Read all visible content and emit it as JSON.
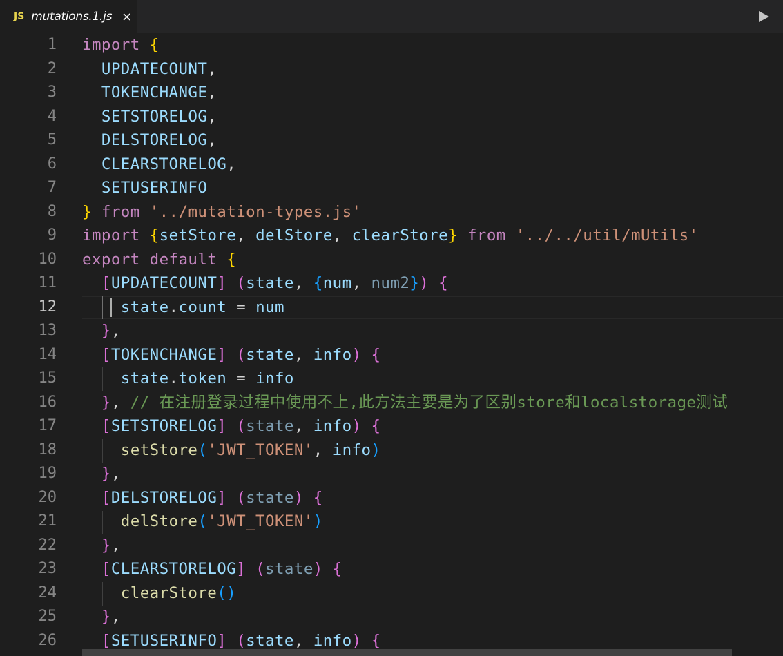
{
  "tab": {
    "icon": "JS",
    "title": "mutations.1.js",
    "close": "×"
  },
  "toolbar": {
    "run_icon": "run-icon"
  },
  "colors": {
    "keyword": "#c586c0",
    "variable": "#9cdcfe",
    "string": "#ce9178",
    "function": "#dcdcaa",
    "comment": "#6a9955"
  },
  "editor": {
    "active_line": 12,
    "lines": [
      {
        "n": "1",
        "tokens": [
          [
            "kw",
            "import"
          ],
          [
            "punc",
            " "
          ],
          [
            "brace1",
            "{"
          ]
        ]
      },
      {
        "n": "2",
        "tokens": [
          [
            "punc",
            "  "
          ],
          [
            "var",
            "UPDATECOUNT"
          ],
          [
            "punc",
            ","
          ]
        ]
      },
      {
        "n": "3",
        "tokens": [
          [
            "punc",
            "  "
          ],
          [
            "var",
            "TOKENCHANGE"
          ],
          [
            "punc",
            ","
          ]
        ]
      },
      {
        "n": "4",
        "tokens": [
          [
            "punc",
            "  "
          ],
          [
            "var",
            "SETSTORELOG"
          ],
          [
            "punc",
            ","
          ]
        ]
      },
      {
        "n": "5",
        "tokens": [
          [
            "punc",
            "  "
          ],
          [
            "var",
            "DELSTORELOG"
          ],
          [
            "punc",
            ","
          ]
        ]
      },
      {
        "n": "6",
        "tokens": [
          [
            "punc",
            "  "
          ],
          [
            "var",
            "CLEARSTORELOG"
          ],
          [
            "punc",
            ","
          ]
        ]
      },
      {
        "n": "7",
        "tokens": [
          [
            "punc",
            "  "
          ],
          [
            "var",
            "SETUSERINFO"
          ]
        ]
      },
      {
        "n": "8",
        "tokens": [
          [
            "brace1",
            "}"
          ],
          [
            "punc",
            " "
          ],
          [
            "kw",
            "from"
          ],
          [
            "punc",
            " "
          ],
          [
            "str",
            "'../mutation-types.js'"
          ]
        ]
      },
      {
        "n": "9",
        "tokens": [
          [
            "kw",
            "import"
          ],
          [
            "punc",
            " "
          ],
          [
            "brace1",
            "{"
          ],
          [
            "var",
            "setStore"
          ],
          [
            "punc",
            ", "
          ],
          [
            "var",
            "delStore"
          ],
          [
            "punc",
            ", "
          ],
          [
            "var",
            "clearStore"
          ],
          [
            "brace1",
            "}"
          ],
          [
            "punc",
            " "
          ],
          [
            "kw",
            "from"
          ],
          [
            "punc",
            " "
          ],
          [
            "str",
            "'../../util/mUtils'"
          ]
        ]
      },
      {
        "n": "10",
        "tokens": [
          [
            "kw",
            "export"
          ],
          [
            "punc",
            " "
          ],
          [
            "kw",
            "default"
          ],
          [
            "punc",
            " "
          ],
          [
            "brace1",
            "{"
          ]
        ]
      },
      {
        "n": "11",
        "tokens": [
          [
            "punc",
            "  "
          ],
          [
            "brace2",
            "["
          ],
          [
            "var",
            "UPDATECOUNT"
          ],
          [
            "brace2",
            "]"
          ],
          [
            "punc",
            " "
          ],
          [
            "brace2",
            "("
          ],
          [
            "var",
            "state"
          ],
          [
            "punc",
            ", "
          ],
          [
            "brace3",
            "{"
          ],
          [
            "var",
            "num"
          ],
          [
            "punc",
            ", "
          ],
          [
            "dim",
            "num2"
          ],
          [
            "brace3",
            "}"
          ],
          [
            "brace2",
            ")"
          ],
          [
            "punc",
            " "
          ],
          [
            "brace2",
            "{"
          ]
        ]
      },
      {
        "n": "12",
        "tokens": [
          [
            "punc",
            "    "
          ],
          [
            "var",
            "state"
          ],
          [
            "punc",
            "."
          ],
          [
            "var",
            "count"
          ],
          [
            "punc",
            " = "
          ],
          [
            "var",
            "num"
          ]
        ]
      },
      {
        "n": "13",
        "tokens": [
          [
            "punc",
            "  "
          ],
          [
            "brace2",
            "}"
          ],
          [
            "punc",
            ","
          ]
        ]
      },
      {
        "n": "14",
        "tokens": [
          [
            "punc",
            "  "
          ],
          [
            "brace2",
            "["
          ],
          [
            "var",
            "TOKENCHANGE"
          ],
          [
            "brace2",
            "]"
          ],
          [
            "punc",
            " "
          ],
          [
            "brace2",
            "("
          ],
          [
            "var",
            "state"
          ],
          [
            "punc",
            ", "
          ],
          [
            "var",
            "info"
          ],
          [
            "brace2",
            ")"
          ],
          [
            "punc",
            " "
          ],
          [
            "brace2",
            "{"
          ]
        ]
      },
      {
        "n": "15",
        "tokens": [
          [
            "punc",
            "    "
          ],
          [
            "var",
            "state"
          ],
          [
            "punc",
            "."
          ],
          [
            "var",
            "token"
          ],
          [
            "punc",
            " = "
          ],
          [
            "var",
            "info"
          ]
        ]
      },
      {
        "n": "16",
        "tokens": [
          [
            "punc",
            "  "
          ],
          [
            "brace2",
            "}"
          ],
          [
            "punc",
            ", "
          ],
          [
            "cmt",
            "// 在注册登录过程中使用不上,此方法主要是为了区别store和localstorage测试"
          ]
        ]
      },
      {
        "n": "17",
        "tokens": [
          [
            "punc",
            "  "
          ],
          [
            "brace2",
            "["
          ],
          [
            "var",
            "SETSTORELOG"
          ],
          [
            "brace2",
            "]"
          ],
          [
            "punc",
            " "
          ],
          [
            "brace2",
            "("
          ],
          [
            "dim",
            "state"
          ],
          [
            "punc",
            ", "
          ],
          [
            "var",
            "info"
          ],
          [
            "brace2",
            ")"
          ],
          [
            "punc",
            " "
          ],
          [
            "brace2",
            "{"
          ]
        ]
      },
      {
        "n": "18",
        "tokens": [
          [
            "punc",
            "    "
          ],
          [
            "fn",
            "setStore"
          ],
          [
            "brace3",
            "("
          ],
          [
            "str",
            "'JWT_TOKEN'"
          ],
          [
            "punc",
            ", "
          ],
          [
            "var",
            "info"
          ],
          [
            "brace3",
            ")"
          ]
        ]
      },
      {
        "n": "19",
        "tokens": [
          [
            "punc",
            "  "
          ],
          [
            "brace2",
            "}"
          ],
          [
            "punc",
            ","
          ]
        ]
      },
      {
        "n": "20",
        "tokens": [
          [
            "punc",
            "  "
          ],
          [
            "brace2",
            "["
          ],
          [
            "var",
            "DELSTORELOG"
          ],
          [
            "brace2",
            "]"
          ],
          [
            "punc",
            " "
          ],
          [
            "brace2",
            "("
          ],
          [
            "dim",
            "state"
          ],
          [
            "brace2",
            ")"
          ],
          [
            "punc",
            " "
          ],
          [
            "brace2",
            "{"
          ]
        ]
      },
      {
        "n": "21",
        "tokens": [
          [
            "punc",
            "    "
          ],
          [
            "fn",
            "delStore"
          ],
          [
            "brace3",
            "("
          ],
          [
            "str",
            "'JWT_TOKEN'"
          ],
          [
            "brace3",
            ")"
          ]
        ]
      },
      {
        "n": "22",
        "tokens": [
          [
            "punc",
            "  "
          ],
          [
            "brace2",
            "}"
          ],
          [
            "punc",
            ","
          ]
        ]
      },
      {
        "n": "23",
        "tokens": [
          [
            "punc",
            "  "
          ],
          [
            "brace2",
            "["
          ],
          [
            "var",
            "CLEARSTORELOG"
          ],
          [
            "brace2",
            "]"
          ],
          [
            "punc",
            " "
          ],
          [
            "brace2",
            "("
          ],
          [
            "dim",
            "state"
          ],
          [
            "brace2",
            ")"
          ],
          [
            "punc",
            " "
          ],
          [
            "brace2",
            "{"
          ]
        ]
      },
      {
        "n": "24",
        "tokens": [
          [
            "punc",
            "    "
          ],
          [
            "fn",
            "clearStore"
          ],
          [
            "brace3",
            "()"
          ]
        ]
      },
      {
        "n": "25",
        "tokens": [
          [
            "punc",
            "  "
          ],
          [
            "brace2",
            "}"
          ],
          [
            "punc",
            ","
          ]
        ]
      },
      {
        "n": "26",
        "tokens": [
          [
            "punc",
            "  "
          ],
          [
            "brace2",
            "["
          ],
          [
            "var",
            "SETUSERINFO"
          ],
          [
            "brace2",
            "]"
          ],
          [
            "punc",
            " "
          ],
          [
            "brace2",
            "("
          ],
          [
            "var",
            "state"
          ],
          [
            "punc",
            ", "
          ],
          [
            "var",
            "info"
          ],
          [
            "brace2",
            ")"
          ],
          [
            "punc",
            " "
          ],
          [
            "brace2",
            "{"
          ]
        ]
      }
    ]
  }
}
